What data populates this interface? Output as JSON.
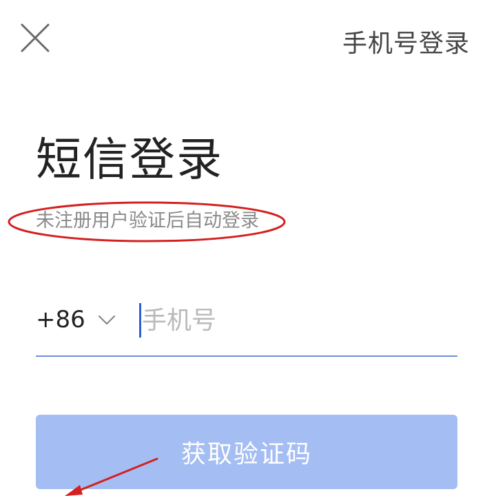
{
  "header": {
    "close_icon": "close-icon",
    "right_link": "手机号登录"
  },
  "main": {
    "title": "短信登录",
    "subtitle": "未注册用户验证后自动登录"
  },
  "phone": {
    "country_code": "+86",
    "dropdown_icon": "chevron-down-icon",
    "placeholder": "手机号",
    "value": ""
  },
  "action": {
    "button_label": "获取验证码",
    "button_color": "#a4bdf2"
  },
  "annotations": {
    "ellipse_color": "#d42020",
    "arrow_color": "#d42020"
  }
}
